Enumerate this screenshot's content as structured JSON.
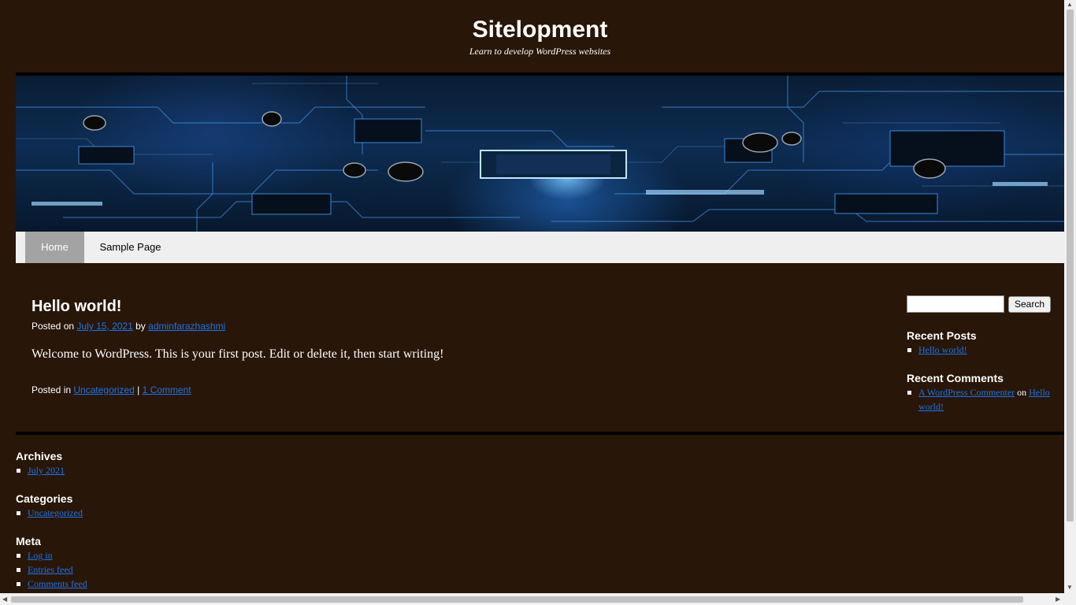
{
  "site": {
    "title": "Sitelopment",
    "description": "Learn to develop WordPress websites"
  },
  "nav": {
    "home": "Home",
    "sample": "Sample Page"
  },
  "post": {
    "title": "Hello world!",
    "posted_on": "Posted on",
    "date": "July 15, 2021",
    "by": "by",
    "author": "adminfarazhashmi",
    "content": "Welcome to WordPress. This is your first post. Edit or delete it, then start writing!",
    "posted_in": "Posted in",
    "category": "Uncategorized",
    "separator": "|",
    "comments": "1 Comment"
  },
  "sidebar": {
    "search_value": "",
    "search_button": "Search",
    "recent_posts_title": "Recent Posts",
    "recent_posts": [
      "Hello world!"
    ],
    "recent_comments_title": "Recent Comments",
    "recent_comment": {
      "author": "A WordPress Commenter",
      "on": "on",
      "post": "Hello world!"
    }
  },
  "footer_widgets": {
    "archives_title": "Archives",
    "archives": [
      "July 2021"
    ],
    "categories_title": "Categories",
    "categories": [
      "Uncategorized"
    ],
    "meta_title": "Meta",
    "meta": [
      "Log in",
      "Entries feed",
      "Comments feed"
    ]
  },
  "colors": {
    "background": "#281608",
    "link": "#1e73e8",
    "nav_background": "#efefef",
    "nav_active": "#a3a3a3"
  },
  "icons": {
    "scroll_up": "triangle-up",
    "scroll_down": "triangle-down",
    "scroll_left": "triangle-left",
    "scroll_right": "triangle-right"
  }
}
